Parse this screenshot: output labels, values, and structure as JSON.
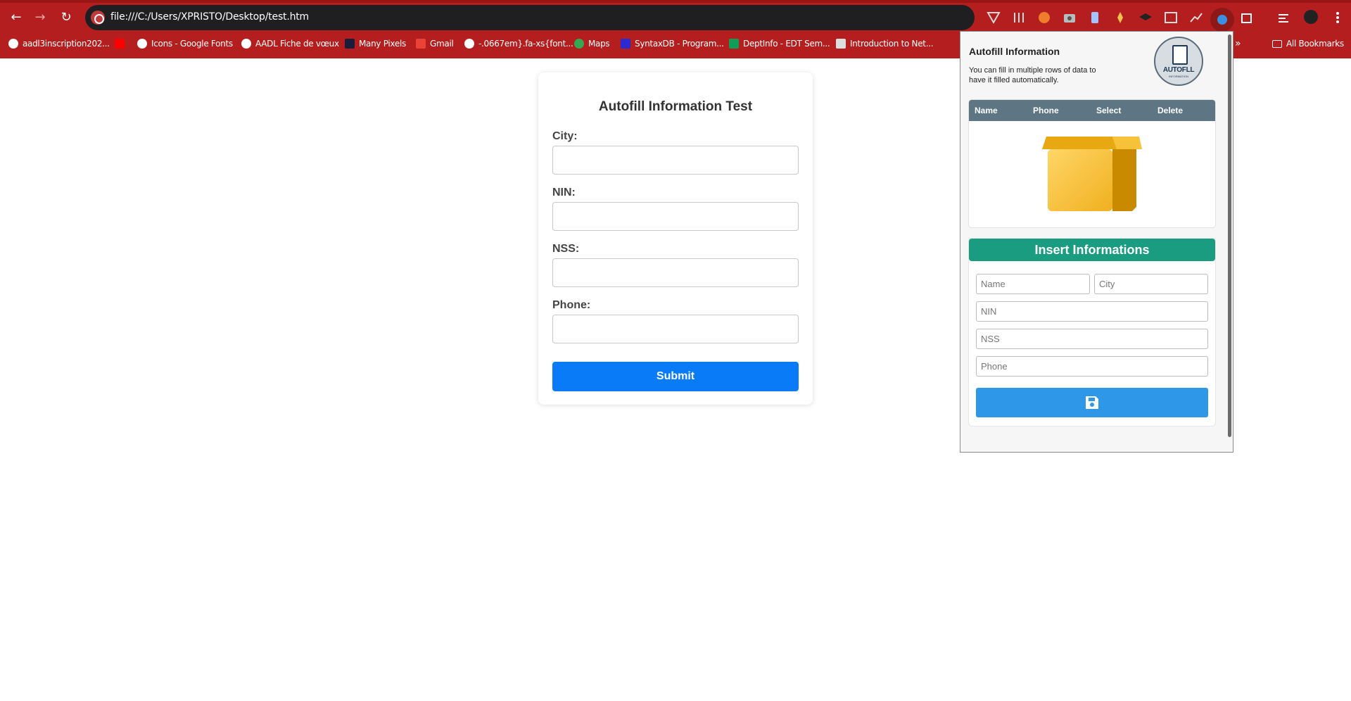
{
  "browser": {
    "url": "file:///C:/Users/XPRISTO/Desktop/test.htm",
    "bookmarks": [
      {
        "label": "aadl3inscription202...",
        "icon": "globe-icon"
      },
      {
        "label": "",
        "icon": "youtube-icon"
      },
      {
        "label": "Icons - Google Fonts",
        "icon": "globe-icon"
      },
      {
        "label": "AADL Fiche de vœux",
        "icon": "globe-icon"
      },
      {
        "label": "Many Pixels",
        "icon": "manypixels-icon"
      },
      {
        "label": "Gmail",
        "icon": "gmail-icon"
      },
      {
        "label": "-.0667em}.fa-xs{font...",
        "icon": "globe-icon"
      },
      {
        "label": "Maps",
        "icon": "maps-icon"
      },
      {
        "label": "SyntaxDB - Program...",
        "icon": "syntaxdb-icon"
      },
      {
        "label": "DeptInfo - EDT Sem...",
        "icon": "sheets-icon"
      },
      {
        "label": "Introduction to Net...",
        "icon": "doc-icon"
      }
    ],
    "all_bookmarks_label": "All Bookmarks"
  },
  "form": {
    "title": "Autofill Information Test",
    "fields": [
      {
        "label": "City:",
        "value": ""
      },
      {
        "label": "NIN:",
        "value": ""
      },
      {
        "label": "NSS:",
        "value": ""
      },
      {
        "label": "Phone:",
        "value": ""
      }
    ],
    "submit_label": "Submit"
  },
  "extension": {
    "title": "Autofill Information",
    "description": "You can fill in multiple rows of data to have it filled automatically.",
    "logo_text": "AUTOFLL",
    "logo_subtext": "INFORMATION",
    "table_columns": [
      "Name",
      "Phone",
      "Select",
      "Delete"
    ],
    "insert_title": "Insert Informations",
    "placeholders": {
      "name": "Name",
      "city": "City",
      "nin": "NIN",
      "nss": "NSS",
      "phone": "Phone"
    },
    "colors": {
      "table_header": "#5e7584",
      "insert_header": "#1a9c81",
      "save_button": "#2e97e8",
      "submit_button": "#0a7bf7",
      "chrome": "#b41e1e"
    }
  }
}
